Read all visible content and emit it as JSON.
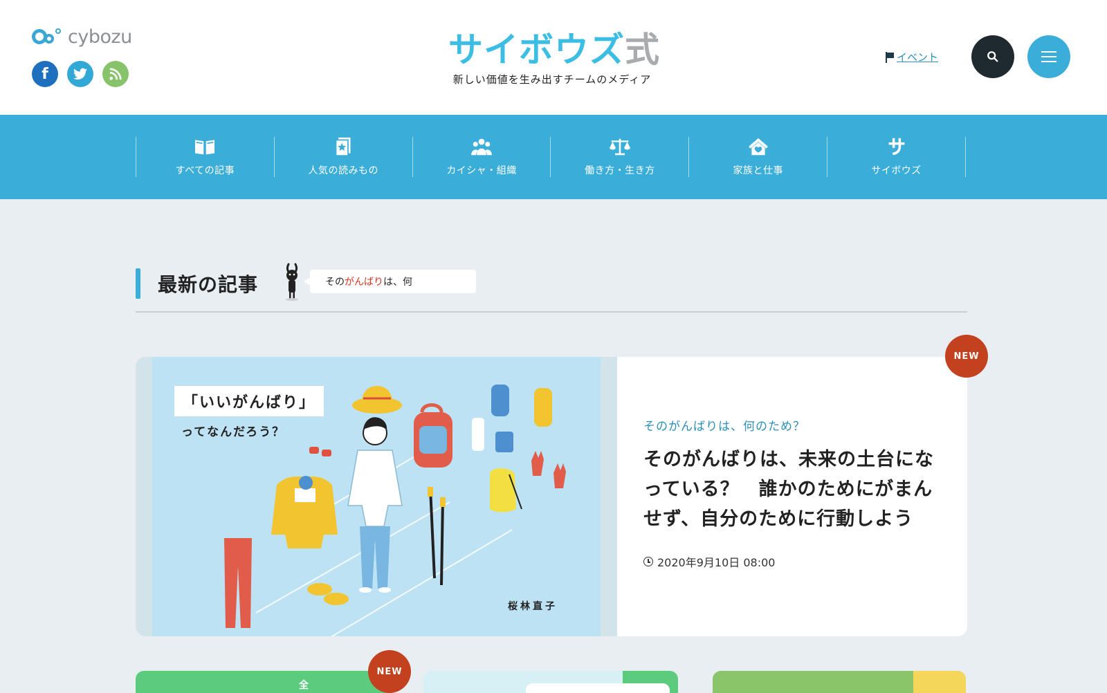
{
  "header": {
    "brand": "cybozu",
    "site_title_main": "サイボウズ",
    "site_title_suffix": "式",
    "site_subtitle": "新しい価値を生み出すチームのメディア",
    "social": [
      {
        "name": "facebook",
        "icon": "facebook-icon",
        "glyph": "f"
      },
      {
        "name": "twitter",
        "icon": "twitter-icon"
      },
      {
        "name": "rss",
        "icon": "rss-icon"
      }
    ],
    "event_link": "イベント",
    "search_icon": "search-icon",
    "menu_icon": "hamburger-menu-icon"
  },
  "nav": {
    "items": [
      {
        "label": "すべての記事",
        "icon": "open-book-icon"
      },
      {
        "label": "人気の読みもの",
        "icon": "starred-bookmark-icon"
      },
      {
        "label": "カイシャ・組織",
        "icon": "people-group-icon"
      },
      {
        "label": "働き方・生き方",
        "icon": "balance-scale-icon"
      },
      {
        "label": "家族と仕事",
        "icon": "house-heart-icon"
      },
      {
        "label": "サイボウズ",
        "icon": "cybozu-sa-icon"
      }
    ]
  },
  "section": {
    "title": "最新の記事",
    "ticker_pre": "その",
    "ticker_highlight": "がんばり",
    "ticker_post": "は、何"
  },
  "featured": {
    "badge": "NEW",
    "image_tagline": "「いいがんばり」",
    "image_tagline2": "ってなんだろう？",
    "image_author": "桜林直子",
    "category": "そのがんばりは、何のため？",
    "headline": "そのがんばりは、未来の土台になっている？　誰かのためにがまんせず、自分のために行動しよう",
    "date": "2020年9月10日 08:00"
  },
  "cards": [
    {
      "badge": "NEW",
      "text": "全"
    },
    {},
    {}
  ],
  "colors": {
    "brand_blue": "#3aaed8",
    "title_cyan": "#3cbde3",
    "new_badge": "#c2411e",
    "background": "#e8eef1"
  }
}
